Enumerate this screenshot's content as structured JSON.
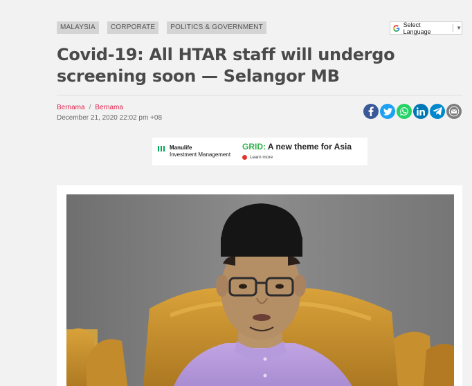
{
  "categories": [
    "MALAYSIA",
    "CORPORATE",
    "POLITICS & GOVERNMENT"
  ],
  "translate": {
    "label": "Select Language",
    "arrow": "▼"
  },
  "article": {
    "title": "Covid-19: All HTAR staff will undergo screening soon — Selangor MB",
    "authors": [
      "Bernama",
      "Bernama"
    ],
    "author_separator": "/",
    "date": "December 21, 2020 22:02 pm +08"
  },
  "share_icons": [
    "facebook-icon",
    "twitter-icon",
    "whatsapp-icon",
    "linkedin-icon",
    "telegram-icon",
    "email-icon"
  ],
  "colors": {
    "facebook": "#3b5998",
    "twitter": "#1da1f2",
    "whatsapp": "#25d366",
    "linkedin": "#0077b5",
    "telegram": "#0088cc",
    "email": "#7d7d7d",
    "author_link": "#e0234e"
  },
  "ad": {
    "brand_line1": "Manulife",
    "brand_line2": "Investment Management",
    "headline_accent": "GRID:",
    "headline_rest": " A new theme for Asia",
    "cta": "Learn more"
  }
}
